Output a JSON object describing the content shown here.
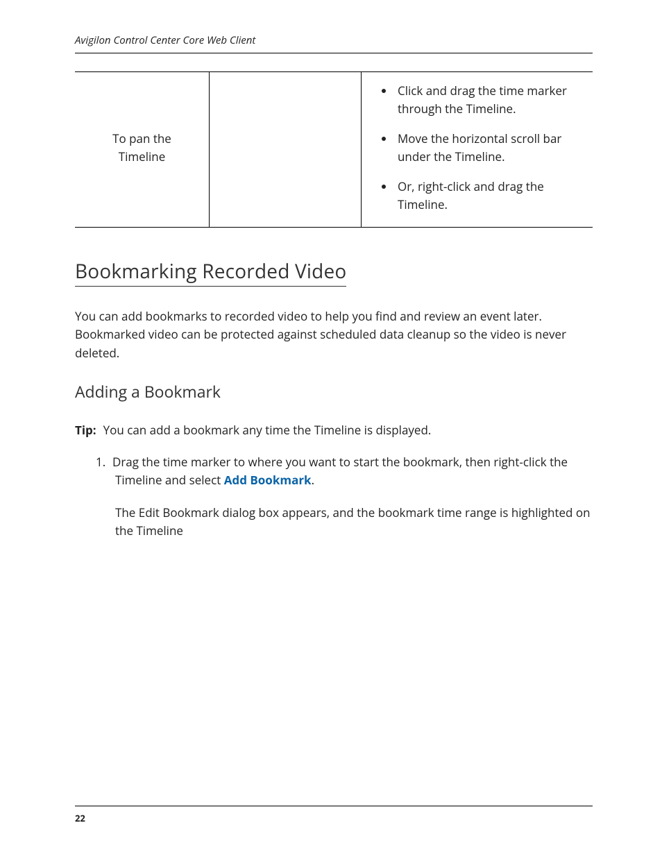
{
  "header": {
    "title": "Avigilon Control Center Core Web Client"
  },
  "table": {
    "row_label_1": "To pan the",
    "row_label_2": "Timeline",
    "bullets": [
      "Click and drag the time marker through the Timeline.",
      "Move the horizontal scroll bar under the Timeline.",
      "Or, right-click and drag the Timeline."
    ]
  },
  "section": {
    "h1": "Bookmarking Recorded Video",
    "intro": "You can add bookmarks to recorded video to help you find and review an event later. Bookmarked video can be protected against scheduled data cleanup so the video is never deleted.",
    "h2": "Adding a Bookmark",
    "tip_label": "Tip:",
    "tip_text": "You can add a bookmark any time the Timeline is displayed.",
    "step1_num": "1.",
    "step1_a": "Drag the time marker to where you want to start the bookmark, then right-click the Timeline and select ",
    "step1_action": "Add Bookmark",
    "step1_b": ".",
    "step1_sub": "The Edit Bookmark dialog box appears, and the bookmark time range is highlighted on the Timeline"
  },
  "footer": {
    "page": "22"
  }
}
